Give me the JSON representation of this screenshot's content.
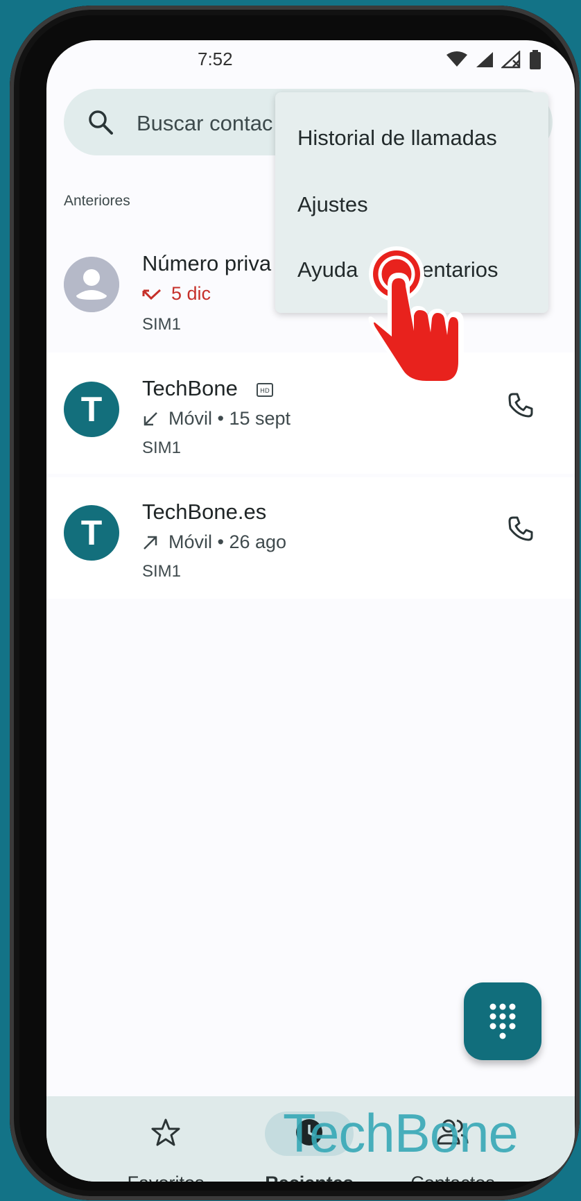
{
  "status_bar": {
    "time": "7:52"
  },
  "search": {
    "placeholder": "Buscar contac"
  },
  "section": {
    "header": "Anteriores"
  },
  "calls": [
    {
      "name": "Número priva",
      "detail": "5 dic",
      "sim": "SIM1",
      "missed": true
    },
    {
      "name": "TechBone",
      "detail": "Móvil • 15 sept",
      "sim": "SIM1",
      "avatar_letter": "T",
      "direction": "incoming"
    },
    {
      "name": "TechBone.es",
      "detail": "Móvil • 26 ago",
      "sim": "SIM1",
      "avatar_letter": "T",
      "direction": "outgoing"
    }
  ],
  "menu": {
    "items": [
      "Historial de llamadas",
      "Ajustes",
      "Ayuda y comentarios"
    ],
    "visible_item_3": "Ayuda",
    "visible_item_3_tail": "mentarios"
  },
  "nav": {
    "items": [
      {
        "label": "Favoritos",
        "icon": "star-icon"
      },
      {
        "label": "Recientes",
        "icon": "clock-icon",
        "selected": true
      },
      {
        "label": "Contactos",
        "icon": "people-icon"
      }
    ]
  },
  "watermark": "TechBone",
  "colors": {
    "accent": "#116e7c",
    "background": "#137387",
    "missed": "#c6302a",
    "tap_indicator": "#e8221d"
  }
}
